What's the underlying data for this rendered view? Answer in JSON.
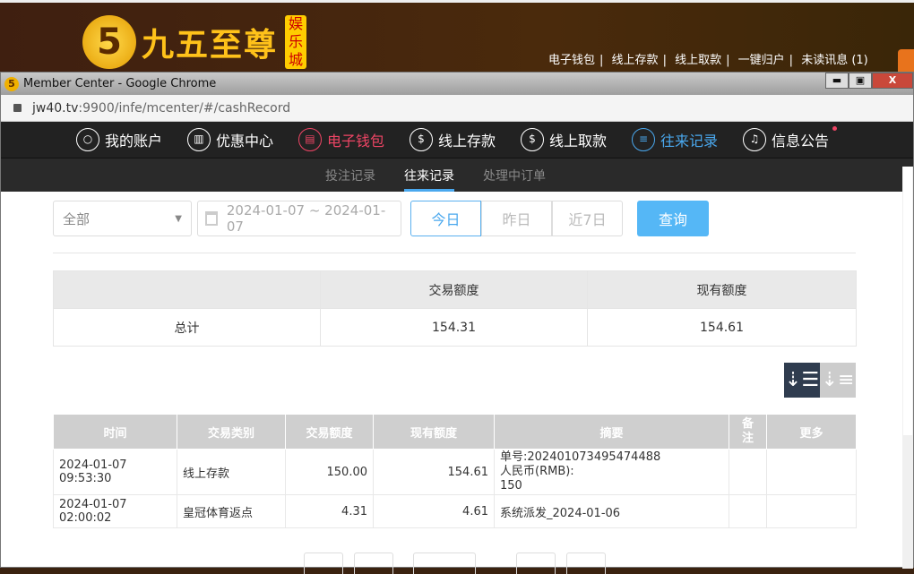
{
  "site": {
    "logo_text": "九五至尊",
    "logo_sub": "娱乐城",
    "logo_mark": "5",
    "links": [
      "电子钱包",
      "线上存款",
      "线上取款",
      "一键归户",
      "未读讯息 (1)"
    ]
  },
  "window": {
    "title": "Member Center - Google Chrome",
    "min": "▬",
    "max": "▣",
    "close": "X",
    "url_host": "jw40.tv",
    "url_rest": ":9900/infe/mcenter/#/cashRecord"
  },
  "nav": [
    {
      "label": "我的账户",
      "icon": "user-icon"
    },
    {
      "label": "优惠中心",
      "icon": "gift-icon"
    },
    {
      "label": "电子钱包",
      "icon": "wallet-icon"
    },
    {
      "label": "线上存款",
      "icon": "deposit-icon"
    },
    {
      "label": "线上取款",
      "icon": "withdraw-icon"
    },
    {
      "label": "往来记录",
      "icon": "record-icon"
    },
    {
      "label": "信息公告",
      "icon": "bell-icon"
    }
  ],
  "subtabs": [
    "投注记录",
    "往来记录",
    "处理中订单"
  ],
  "filters": {
    "type": "全部",
    "date_range": "2024-01-07 ~ 2024-01-07",
    "quick": [
      "今日",
      "昨日",
      "近7日"
    ],
    "query": "查询"
  },
  "summary": {
    "headers": [
      "",
      "交易额度",
      "现有额度"
    ],
    "row": [
      "总计",
      "154.31",
      "154.61"
    ]
  },
  "table": {
    "headers": [
      "时间",
      "交易类别",
      "交易额度",
      "现有额度",
      "摘要",
      "备注",
      "更多"
    ],
    "rows": [
      {
        "time": "2024-01-07 09:53:30",
        "type": "线上存款",
        "amount": "150.00",
        "balance": "154.61",
        "summary": [
          "单号:202401073495474488",
          "人民币(RMB):",
          "150"
        ],
        "note": "",
        "more": ""
      },
      {
        "time": "2024-01-07 02:00:02",
        "type": "皇冠体育返点",
        "amount": "4.31",
        "balance": "4.61",
        "summary": [
          "系统派发_2024-01-06"
        ],
        "note": "",
        "more": ""
      }
    ]
  }
}
